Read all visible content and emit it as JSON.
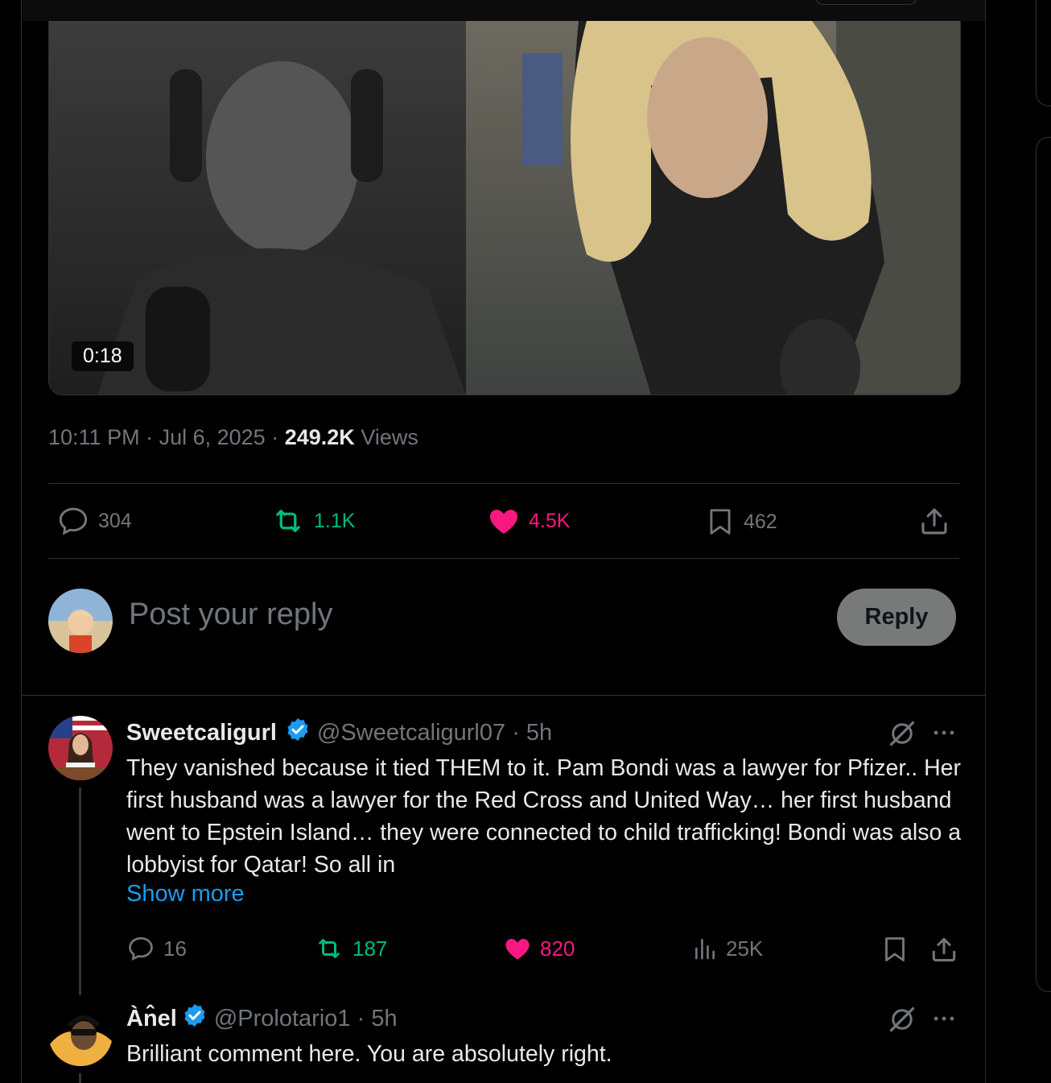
{
  "video": {
    "duration": "0:18"
  },
  "post": {
    "time": "10:11 PM",
    "date": "Jul 6, 2025",
    "views_count": "249.2K",
    "views_label": "Views",
    "replies": "304",
    "reposts": "1.1K",
    "likes": "4.5K",
    "bookmarks": "462"
  },
  "composer": {
    "placeholder": "Post your reply",
    "button": "Reply"
  },
  "replies": [
    {
      "name": "Sweetcaligurl",
      "handle": "@Sweetcaligurl07",
      "time": "5h",
      "text": "They vanished because it tied THEM to it. Pam Bondi was a lawyer for Pfizer..  Her first husband was a lawyer for the Red Cross and United Way… her first husband went to Epstein Island… they were connected to child trafficking! Bondi was also a lobbyist for Qatar! So all in",
      "show_more": "Show more",
      "replies": "16",
      "reposts": "187",
      "likes": "820",
      "views": "25K"
    },
    {
      "name": "Àn̂el",
      "handle": "@Prolotario1",
      "time": "5h",
      "text": "Brilliant comment here. You are absolutely right."
    }
  ],
  "colors": {
    "background": "#000000",
    "accent": "#1d9bf0",
    "like": "#f91880",
    "repost": "#00ba7c",
    "muted": "#71767b"
  },
  "icons": [
    "reply-icon",
    "repost-icon",
    "heart-icon",
    "bookmark-icon",
    "share-icon",
    "views-icon",
    "grok-icon",
    "more-icon",
    "verified-badge-icon"
  ]
}
